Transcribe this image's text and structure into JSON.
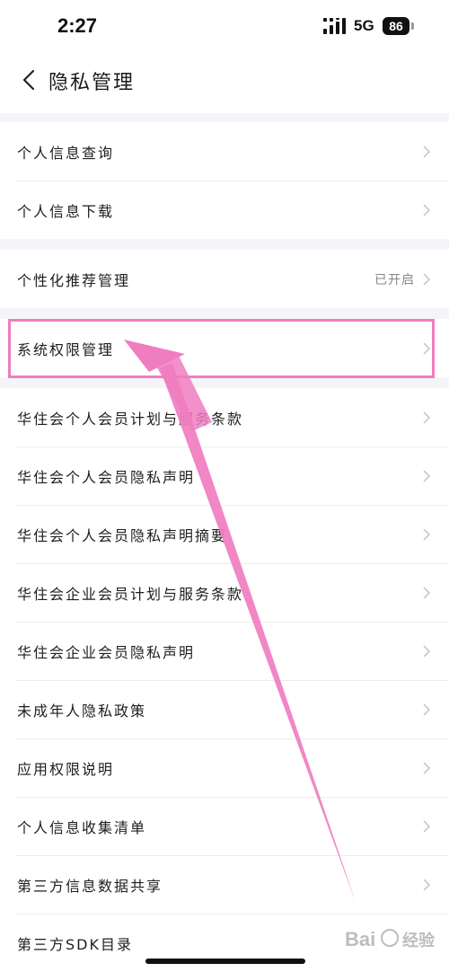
{
  "status_bar": {
    "time": "2:27",
    "network": "5G",
    "battery": "86"
  },
  "header": {
    "title": "隐私管理",
    "back_icon": "chevron-left-icon"
  },
  "groups": [
    {
      "items": [
        {
          "label": "个人信息查询"
        },
        {
          "label": "个人信息下载"
        }
      ]
    },
    {
      "items": [
        {
          "label": "个性化推荐管理",
          "value": "已开启"
        }
      ]
    },
    {
      "items": [
        {
          "label": "系统权限管理"
        },
        {
          "label": "华住会个人会员计划与服务条款"
        },
        {
          "label": "华住会个人会员隐私声明"
        },
        {
          "label": "华住会个人会员隐私声明摘要"
        },
        {
          "label": "华住会企业会员计划与服务条款"
        },
        {
          "label": "华住会企业会员隐私声明"
        },
        {
          "label": "未成年人隐私政策"
        },
        {
          "label": "应用权限说明"
        },
        {
          "label": "个人信息收集清单"
        },
        {
          "label": "第三方信息数据共享"
        },
        {
          "label": "第三方SDK目录"
        }
      ]
    }
  ],
  "annotation": {
    "color": "#f07dc0",
    "highlighted_item": "系统权限管理"
  },
  "colors": {
    "separator_background": "#f4f5f9",
    "chevron": "#c4c4c4",
    "secondary_text": "#888888"
  },
  "watermark": {
    "logo_text": "Bai经验"
  }
}
